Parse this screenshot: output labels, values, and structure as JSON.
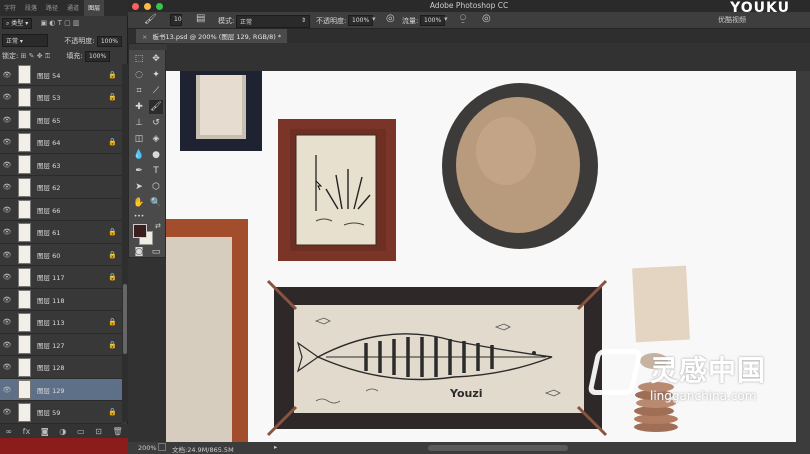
{
  "app": {
    "title": "Adobe Photoshop CC",
    "document_tab": "板书13.psd @ 200% (图层 129, RGB/8) *"
  },
  "watermark": {
    "top_right": "YOUKU",
    "brand": "灵感中国",
    "url": "lingganchina.com",
    "corner_tag": "优酷视频"
  },
  "layers_panel": {
    "tabs": [
      "字符",
      "段落",
      "路径",
      "通道",
      "图层"
    ],
    "active_tab": "图层",
    "filter_kind": "类型",
    "blend_mode": "正常",
    "opacity_label": "不透明度:",
    "opacity_value": "100%",
    "lock_label": "锁定:",
    "fill_label": "填充:",
    "fill_value": "100%",
    "layers": [
      {
        "name": "图层 54",
        "locked": true,
        "selected": false
      },
      {
        "name": "图层 53",
        "locked": true,
        "selected": false
      },
      {
        "name": "图层 65",
        "locked": false,
        "selected": false
      },
      {
        "name": "图层 64",
        "locked": true,
        "selected": false
      },
      {
        "name": "图层 63",
        "locked": false,
        "selected": false
      },
      {
        "name": "图层 62",
        "locked": false,
        "selected": false
      },
      {
        "name": "图层 66",
        "locked": false,
        "selected": false
      },
      {
        "name": "图层 61",
        "locked": true,
        "selected": false
      },
      {
        "name": "图层 60",
        "locked": true,
        "selected": false
      },
      {
        "name": "图层 117",
        "locked": true,
        "selected": false
      },
      {
        "name": "图层 118",
        "locked": false,
        "selected": false
      },
      {
        "name": "图层 113",
        "locked": true,
        "selected": false
      },
      {
        "name": "图层 127",
        "locked": true,
        "selected": false
      },
      {
        "name": "图层 128",
        "locked": false,
        "selected": false
      },
      {
        "name": "图层 129",
        "locked": false,
        "selected": true
      },
      {
        "name": "图层 59",
        "locked": true,
        "selected": false
      }
    ],
    "footer_icons": [
      "link-icon",
      "fx-icon",
      "mask-icon",
      "adjustment-icon",
      "folder-icon",
      "new-layer-icon",
      "trash-icon"
    ]
  },
  "options_bar": {
    "brush_size": "10",
    "mode_label": "模式:",
    "mode_value": "正常",
    "opacity_label": "不透明度:",
    "opacity_value": "100%",
    "flow_label": "流量:",
    "flow_value": "100%"
  },
  "status_bar": {
    "zoom": "200%",
    "doc_info": "文档:24.9M/865.5M"
  },
  "colors": {
    "panel_bg": "#383838",
    "selected_layer": "#5e6f88",
    "foreground_swatch": "#3a1f1c",
    "background_swatch": "#f1ede4"
  },
  "canvas_text": {
    "signature": "Youzi"
  }
}
